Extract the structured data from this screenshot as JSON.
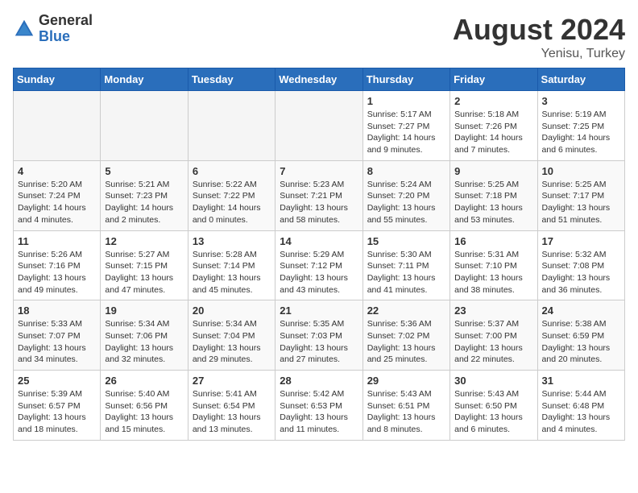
{
  "logo": {
    "general": "General",
    "blue": "Blue"
  },
  "title": "August 2024",
  "subtitle": "Yenisu, Turkey",
  "days_of_week": [
    "Sunday",
    "Monday",
    "Tuesday",
    "Wednesday",
    "Thursday",
    "Friday",
    "Saturday"
  ],
  "weeks": [
    [
      {
        "day": "",
        "empty": true
      },
      {
        "day": "",
        "empty": true
      },
      {
        "day": "",
        "empty": true
      },
      {
        "day": "",
        "empty": true
      },
      {
        "day": "1",
        "sunrise": "5:17 AM",
        "sunset": "7:27 PM",
        "daylight": "14 hours and 9 minutes."
      },
      {
        "day": "2",
        "sunrise": "5:18 AM",
        "sunset": "7:26 PM",
        "daylight": "14 hours and 7 minutes."
      },
      {
        "day": "3",
        "sunrise": "5:19 AM",
        "sunset": "7:25 PM",
        "daylight": "14 hours and 6 minutes."
      }
    ],
    [
      {
        "day": "4",
        "sunrise": "5:20 AM",
        "sunset": "7:24 PM",
        "daylight": "14 hours and 4 minutes."
      },
      {
        "day": "5",
        "sunrise": "5:21 AM",
        "sunset": "7:23 PM",
        "daylight": "14 hours and 2 minutes."
      },
      {
        "day": "6",
        "sunrise": "5:22 AM",
        "sunset": "7:22 PM",
        "daylight": "14 hours and 0 minutes."
      },
      {
        "day": "7",
        "sunrise": "5:23 AM",
        "sunset": "7:21 PM",
        "daylight": "13 hours and 58 minutes."
      },
      {
        "day": "8",
        "sunrise": "5:24 AM",
        "sunset": "7:20 PM",
        "daylight": "13 hours and 55 minutes."
      },
      {
        "day": "9",
        "sunrise": "5:25 AM",
        "sunset": "7:18 PM",
        "daylight": "13 hours and 53 minutes."
      },
      {
        "day": "10",
        "sunrise": "5:25 AM",
        "sunset": "7:17 PM",
        "daylight": "13 hours and 51 minutes."
      }
    ],
    [
      {
        "day": "11",
        "sunrise": "5:26 AM",
        "sunset": "7:16 PM",
        "daylight": "13 hours and 49 minutes."
      },
      {
        "day": "12",
        "sunrise": "5:27 AM",
        "sunset": "7:15 PM",
        "daylight": "13 hours and 47 minutes."
      },
      {
        "day": "13",
        "sunrise": "5:28 AM",
        "sunset": "7:14 PM",
        "daylight": "13 hours and 45 minutes."
      },
      {
        "day": "14",
        "sunrise": "5:29 AM",
        "sunset": "7:12 PM",
        "daylight": "13 hours and 43 minutes."
      },
      {
        "day": "15",
        "sunrise": "5:30 AM",
        "sunset": "7:11 PM",
        "daylight": "13 hours and 41 minutes."
      },
      {
        "day": "16",
        "sunrise": "5:31 AM",
        "sunset": "7:10 PM",
        "daylight": "13 hours and 38 minutes."
      },
      {
        "day": "17",
        "sunrise": "5:32 AM",
        "sunset": "7:08 PM",
        "daylight": "13 hours and 36 minutes."
      }
    ],
    [
      {
        "day": "18",
        "sunrise": "5:33 AM",
        "sunset": "7:07 PM",
        "daylight": "13 hours and 34 minutes."
      },
      {
        "day": "19",
        "sunrise": "5:34 AM",
        "sunset": "7:06 PM",
        "daylight": "13 hours and 32 minutes."
      },
      {
        "day": "20",
        "sunrise": "5:34 AM",
        "sunset": "7:04 PM",
        "daylight": "13 hours and 29 minutes."
      },
      {
        "day": "21",
        "sunrise": "5:35 AM",
        "sunset": "7:03 PM",
        "daylight": "13 hours and 27 minutes."
      },
      {
        "day": "22",
        "sunrise": "5:36 AM",
        "sunset": "7:02 PM",
        "daylight": "13 hours and 25 minutes."
      },
      {
        "day": "23",
        "sunrise": "5:37 AM",
        "sunset": "7:00 PM",
        "daylight": "13 hours and 22 minutes."
      },
      {
        "day": "24",
        "sunrise": "5:38 AM",
        "sunset": "6:59 PM",
        "daylight": "13 hours and 20 minutes."
      }
    ],
    [
      {
        "day": "25",
        "sunrise": "5:39 AM",
        "sunset": "6:57 PM",
        "daylight": "13 hours and 18 minutes."
      },
      {
        "day": "26",
        "sunrise": "5:40 AM",
        "sunset": "6:56 PM",
        "daylight": "13 hours and 15 minutes."
      },
      {
        "day": "27",
        "sunrise": "5:41 AM",
        "sunset": "6:54 PM",
        "daylight": "13 hours and 13 minutes."
      },
      {
        "day": "28",
        "sunrise": "5:42 AM",
        "sunset": "6:53 PM",
        "daylight": "13 hours and 11 minutes."
      },
      {
        "day": "29",
        "sunrise": "5:43 AM",
        "sunset": "6:51 PM",
        "daylight": "13 hours and 8 minutes."
      },
      {
        "day": "30",
        "sunrise": "5:43 AM",
        "sunset": "6:50 PM",
        "daylight": "13 hours and 6 minutes."
      },
      {
        "day": "31",
        "sunrise": "5:44 AM",
        "sunset": "6:48 PM",
        "daylight": "13 hours and 4 minutes."
      }
    ]
  ]
}
